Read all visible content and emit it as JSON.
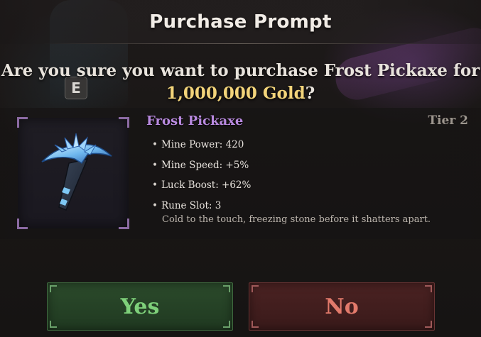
{
  "dialog": {
    "title": "Purchase Prompt",
    "question_prefix": "Are you sure you want to purchase Frost Pickaxe for",
    "price": "1,000,000 Gold",
    "question_suffix": "?"
  },
  "key_hint": {
    "label": "E"
  },
  "item": {
    "name": "Frost Pickaxe",
    "tier": "Tier 2",
    "icon": "frost-pickaxe-icon",
    "stats": [
      "Mine Power: 420",
      "Mine Speed: +5%",
      "Luck Boost: +62%",
      "Rune Slot: 3"
    ],
    "flavor": "Cold to the touch, freezing stone before it shatters apart."
  },
  "buttons": {
    "yes_label": "Yes",
    "no_label": "No"
  },
  "colors": {
    "item_name": "#b98ae0",
    "price": "#f3d47a",
    "yes": "#7ed07a",
    "no": "#e27a6b"
  }
}
